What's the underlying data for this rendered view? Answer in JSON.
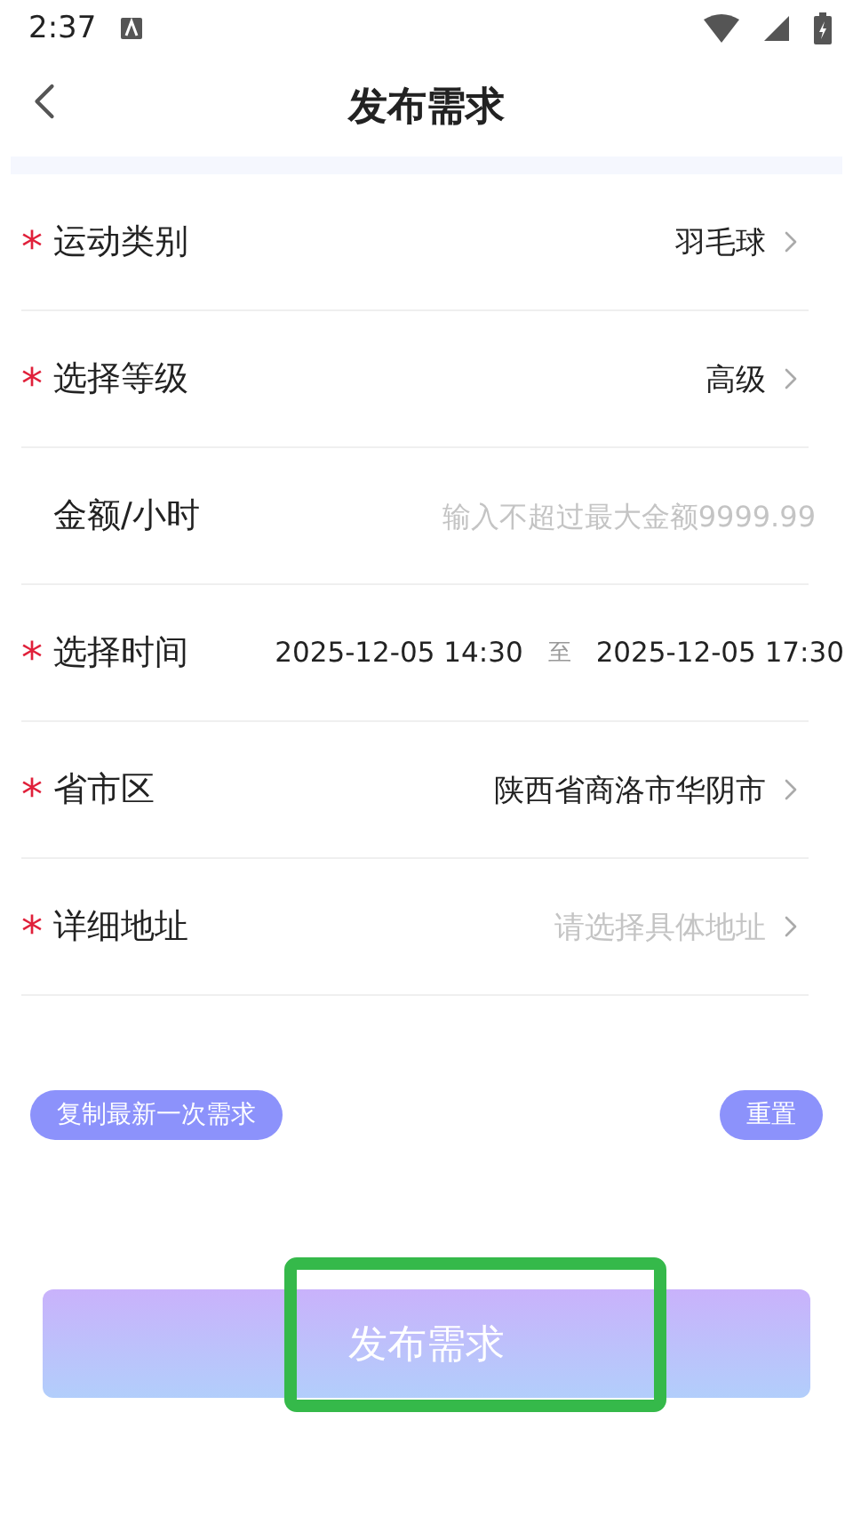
{
  "status_bar": {
    "time": "2:37"
  },
  "header": {
    "title": "发布需求"
  },
  "fields": [
    {
      "kind": "select",
      "mark": "*",
      "label": "运动类别",
      "value": "羽毛球"
    },
    {
      "kind": "select",
      "mark": "*",
      "label": "选择等级",
      "value": "高级"
    },
    {
      "kind": "input",
      "label": "金额/小时",
      "placeholder": "输入不超过最大金额9999.99"
    },
    {
      "kind": "range",
      "mark": "*",
      "label": "选择时间",
      "start": "2025-12-05 14:30",
      "separator": "至",
      "end": "2025-12-05 17:30"
    },
    {
      "kind": "select",
      "mark": "*",
      "label": "省市区",
      "value": "陕西省商洛市华阴市"
    },
    {
      "kind": "select",
      "mark": "*",
      "label": "详细地址",
      "placeholder": "请选择具体地址"
    }
  ],
  "actions": [
    {
      "label": "复制最新一次需求"
    },
    {
      "label": "重置"
    }
  ],
  "submit": {
    "label": "发布需求",
    "highlighted": true
  }
}
